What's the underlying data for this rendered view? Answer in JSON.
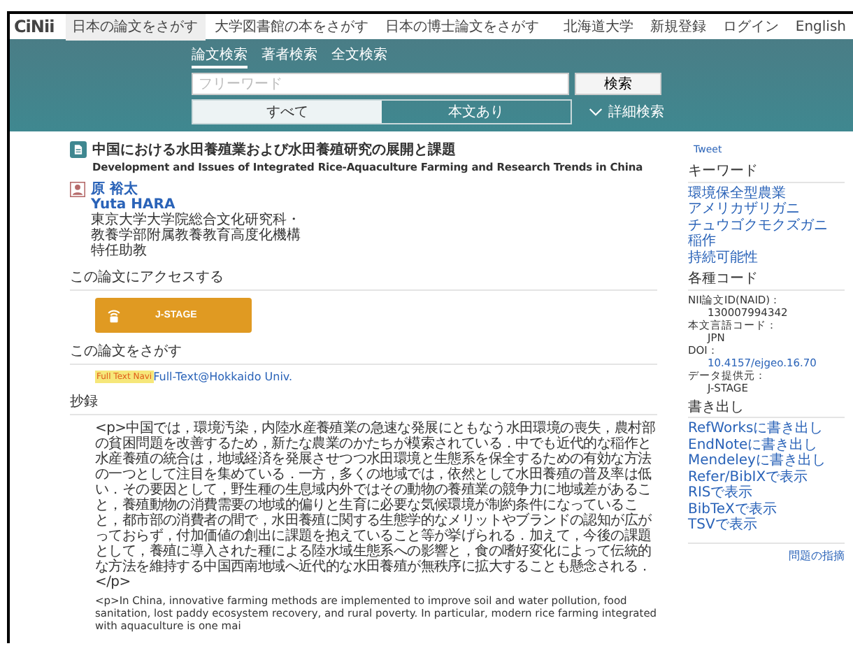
{
  "header": {
    "logo": "CiNii",
    "nav": [
      {
        "label": "日本の論文をさがす",
        "selected": true
      },
      {
        "label": "大学図書館の本をさがす",
        "selected": false
      },
      {
        "label": "日本の博士論文をさがす",
        "selected": false
      }
    ],
    "links": [
      "北海道大学",
      "新規登録",
      "ログイン",
      "English"
    ]
  },
  "search": {
    "tabs": [
      {
        "label": "論文検索",
        "selected": true
      },
      {
        "label": "著者検索",
        "selected": false
      },
      {
        "label": "全文検索",
        "selected": false
      }
    ],
    "placeholder": "フリーワード",
    "button": "検索",
    "filters": [
      {
        "label": "すべて",
        "selected": true
      },
      {
        "label": "本文あり",
        "selected": false
      }
    ],
    "advanced": "詳細検索"
  },
  "article": {
    "title_ja": "中国における水田養殖業および水田養殖研究の展開と課題",
    "title_en": "Development and Issues of Integrated Rice-Aquaculture Farming and Research Trends in China",
    "author_ja": "原 裕太",
    "author_en": "Yuta HARA",
    "affiliation": "東京大学大学院総合文化研究科・教養学部附属教養教育高度化機構特任助教"
  },
  "access": {
    "heading": "この論文にアクセスする",
    "button": "J-STAGE"
  },
  "find": {
    "heading": "この論文をさがす",
    "badge": "Full Text Navi",
    "link": "Full-Text@Hokkaido Univ."
  },
  "abstract": {
    "heading": "抄録",
    "paragraphs": [
      "<p>中国では，環境汚染，内陸水産養殖業の急速な発展にともなう水田環境の喪失，農村部の貧困問題を改善するため，新たな農業のかたちが模索されている．中でも近代的な稲作と水産養殖の統合は，地域経済を発展させつつ水田環境と生態系を保全するための有効な方法の一つとして注目を集めている．一方，多くの地域では，依然として水田養殖の普及率は低い．その要因として，野生種の生息域内外ではその動物の養殖業の競争力に地域差があること，養殖動物の消費需要の地域的偏りと生育に必要な気候環境が制約条件になっていること，都市部の消費者の間で，水田養殖に関する生態学的なメリットやブランドの認知が広がっておらず，付加価値の創出に課題を抱えていること等が挙げられる．加えて，今後の課題として，養殖に導入された種による陸水域生態系への影響と，食の嗜好変化によって伝統的な方法を維持する中国西南地域へ近代的な水田養殖が無秩序に拡大することも懸念される．</p>",
      "<p>In China, innovative farming methods are implemented to improve soil and water pollution, food sanitation, lost paddy ecosystem recovery, and rural poverty. In particular, modern rice farming integrated with aquaculture is one mai"
    ]
  },
  "sidebar": {
    "tweet": "Tweet",
    "keywords": {
      "heading": "キーワード",
      "items": [
        "環境保全型農業",
        "アメリカザリガニ",
        "チュウゴクモクズガニ",
        "稲作",
        "持続可能性"
      ]
    },
    "codes": {
      "heading": "各種コード",
      "items": [
        {
          "label": "NII論文ID(NAID)：",
          "value": "130007994342",
          "kind": "text"
        },
        {
          "label": "本文言語コード：",
          "value": "JPN",
          "kind": "text"
        },
        {
          "label": "DOI：",
          "value": "10.4157/ejgeo.16.70",
          "kind": "link"
        },
        {
          "label": "データ提供元：",
          "value": "J-STAGE",
          "kind": "text"
        }
      ]
    },
    "export": {
      "heading": "書き出し",
      "items": [
        "RefWorksに書き出し",
        "EndNoteに書き出し",
        "Mendeleyに書き出し",
        "Refer/BibIXで表示",
        "RISで表示",
        "BibTeXで表示",
        "TSVで表示"
      ]
    },
    "report": "問題の指摘"
  }
}
